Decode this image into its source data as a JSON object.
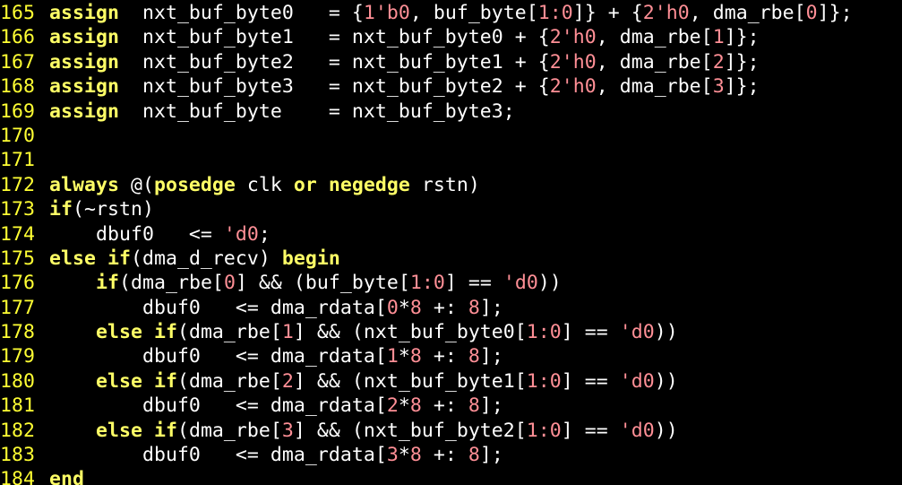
{
  "editor": {
    "colors": {
      "background": "#000000",
      "line_number": "#ffff33",
      "keyword": "#ffff66",
      "identifier": "#ffffff",
      "number": "#ff8f96"
    },
    "lines": [
      {
        "n": "165",
        "tokens": [
          [
            "kw",
            "assign"
          ],
          [
            "id",
            "  nxt_buf_byte0   = {"
          ],
          [
            "num",
            "1'b0"
          ],
          [
            "id",
            ", buf_byte["
          ],
          [
            "num",
            "1:0"
          ],
          [
            "id",
            "]} + {"
          ],
          [
            "num",
            "2'h0"
          ],
          [
            "id",
            ", dma_rbe["
          ],
          [
            "num",
            "0"
          ],
          [
            "id",
            "]};"
          ]
        ]
      },
      {
        "n": "166",
        "tokens": [
          [
            "kw",
            "assign"
          ],
          [
            "id",
            "  nxt_buf_byte1   = nxt_buf_byte0 + {"
          ],
          [
            "num",
            "2'h0"
          ],
          [
            "id",
            ", dma_rbe["
          ],
          [
            "num",
            "1"
          ],
          [
            "id",
            "]};"
          ]
        ]
      },
      {
        "n": "167",
        "tokens": [
          [
            "kw",
            "assign"
          ],
          [
            "id",
            "  nxt_buf_byte2   = nxt_buf_byte1 + {"
          ],
          [
            "num",
            "2'h0"
          ],
          [
            "id",
            ", dma_rbe["
          ],
          [
            "num",
            "2"
          ],
          [
            "id",
            "]};"
          ]
        ]
      },
      {
        "n": "168",
        "tokens": [
          [
            "kw",
            "assign"
          ],
          [
            "id",
            "  nxt_buf_byte3   = nxt_buf_byte2 + {"
          ],
          [
            "num",
            "2'h0"
          ],
          [
            "id",
            ", dma_rbe["
          ],
          [
            "num",
            "3"
          ],
          [
            "id",
            "]};"
          ]
        ]
      },
      {
        "n": "169",
        "tokens": [
          [
            "kw",
            "assign"
          ],
          [
            "id",
            "  nxt_buf_byte    = nxt_buf_byte3;"
          ]
        ]
      },
      {
        "n": "170",
        "tokens": []
      },
      {
        "n": "171",
        "tokens": []
      },
      {
        "n": "172",
        "tokens": [
          [
            "kw",
            "always"
          ],
          [
            "id",
            " @("
          ],
          [
            "kw",
            "posedge"
          ],
          [
            "id",
            " clk "
          ],
          [
            "kw",
            "or"
          ],
          [
            "id",
            " "
          ],
          [
            "kw",
            "negedge"
          ],
          [
            "id",
            " rstn)"
          ]
        ]
      },
      {
        "n": "173",
        "tokens": [
          [
            "kw",
            "if"
          ],
          [
            "id",
            "(~rstn)"
          ]
        ]
      },
      {
        "n": "174",
        "tokens": [
          [
            "id",
            "    dbuf0   <= "
          ],
          [
            "num",
            "'d0"
          ],
          [
            "id",
            ";"
          ]
        ]
      },
      {
        "n": "175",
        "tokens": [
          [
            "kw",
            "else if"
          ],
          [
            "id",
            "(dma_d_recv) "
          ],
          [
            "kw",
            "begin"
          ]
        ]
      },
      {
        "n": "176",
        "tokens": [
          [
            "id",
            "    "
          ],
          [
            "kw",
            "if"
          ],
          [
            "id",
            "(dma_rbe["
          ],
          [
            "num",
            "0"
          ],
          [
            "id",
            "] && (buf_byte["
          ],
          [
            "num",
            "1:0"
          ],
          [
            "id",
            "] == "
          ],
          [
            "num",
            "'d0"
          ],
          [
            "id",
            "))"
          ]
        ]
      },
      {
        "n": "177",
        "tokens": [
          [
            "id",
            "        dbuf0   <= dma_rdata["
          ],
          [
            "num",
            "0"
          ],
          [
            "id",
            "*"
          ],
          [
            "num",
            "8"
          ],
          [
            "id",
            " +: "
          ],
          [
            "num",
            "8"
          ],
          [
            "id",
            "];"
          ]
        ]
      },
      {
        "n": "178",
        "tokens": [
          [
            "id",
            "    "
          ],
          [
            "kw",
            "else if"
          ],
          [
            "id",
            "(dma_rbe["
          ],
          [
            "num",
            "1"
          ],
          [
            "id",
            "] && (nxt_buf_byte0["
          ],
          [
            "num",
            "1:0"
          ],
          [
            "id",
            "] == "
          ],
          [
            "num",
            "'d0"
          ],
          [
            "id",
            "))"
          ]
        ]
      },
      {
        "n": "179",
        "tokens": [
          [
            "id",
            "        dbuf0   <= dma_rdata["
          ],
          [
            "num",
            "1"
          ],
          [
            "id",
            "*"
          ],
          [
            "num",
            "8"
          ],
          [
            "id",
            " +: "
          ],
          [
            "num",
            "8"
          ],
          [
            "id",
            "];"
          ]
        ]
      },
      {
        "n": "180",
        "tokens": [
          [
            "id",
            "    "
          ],
          [
            "kw",
            "else if"
          ],
          [
            "id",
            "(dma_rbe["
          ],
          [
            "num",
            "2"
          ],
          [
            "id",
            "] && (nxt_buf_byte1["
          ],
          [
            "num",
            "1:0"
          ],
          [
            "id",
            "] == "
          ],
          [
            "num",
            "'d0"
          ],
          [
            "id",
            "))"
          ]
        ]
      },
      {
        "n": "181",
        "tokens": [
          [
            "id",
            "        dbuf0   <= dma_rdata["
          ],
          [
            "num",
            "2"
          ],
          [
            "id",
            "*"
          ],
          [
            "num",
            "8"
          ],
          [
            "id",
            " +: "
          ],
          [
            "num",
            "8"
          ],
          [
            "id",
            "];"
          ]
        ]
      },
      {
        "n": "182",
        "tokens": [
          [
            "id",
            "    "
          ],
          [
            "kw",
            "else if"
          ],
          [
            "id",
            "(dma_rbe["
          ],
          [
            "num",
            "3"
          ],
          [
            "id",
            "] && (nxt_buf_byte2["
          ],
          [
            "num",
            "1:0"
          ],
          [
            "id",
            "] == "
          ],
          [
            "num",
            "'d0"
          ],
          [
            "id",
            "))"
          ]
        ]
      },
      {
        "n": "183",
        "tokens": [
          [
            "id",
            "        dbuf0   <= dma_rdata["
          ],
          [
            "num",
            "3"
          ],
          [
            "id",
            "*"
          ],
          [
            "num",
            "8"
          ],
          [
            "id",
            " +: "
          ],
          [
            "num",
            "8"
          ],
          [
            "id",
            "];"
          ]
        ]
      },
      {
        "n": "184",
        "tokens": [
          [
            "kw",
            "end"
          ]
        ]
      }
    ]
  }
}
